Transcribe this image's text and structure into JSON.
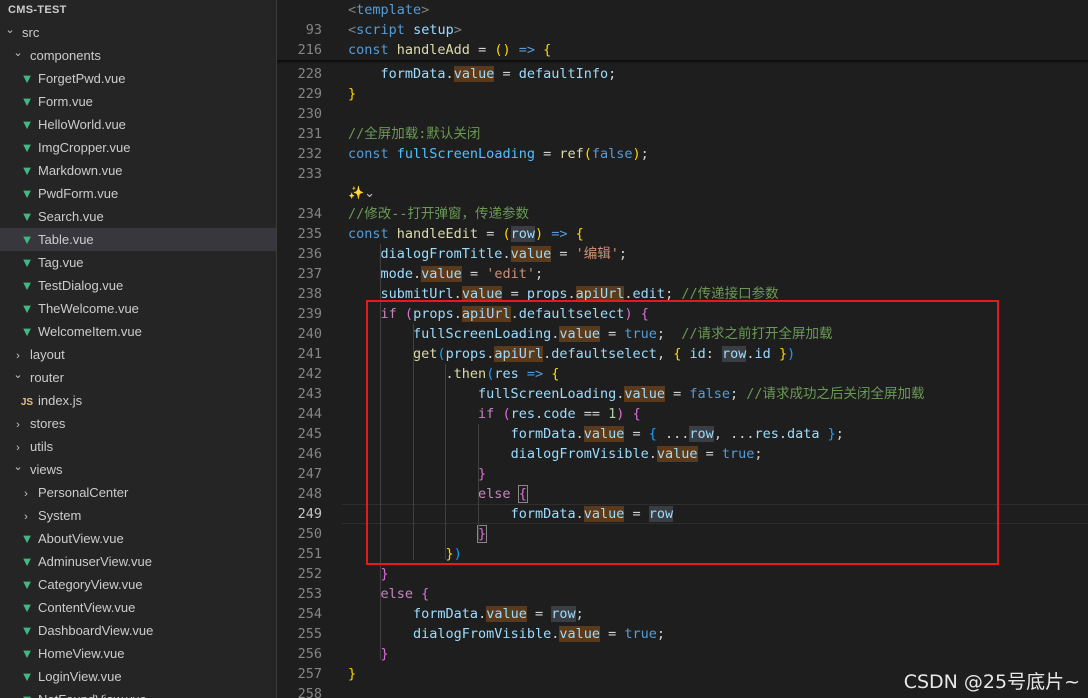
{
  "explorer": {
    "root_label": "CMS-TEST",
    "items": [
      {
        "label": "src",
        "kind": "folder-open",
        "indent": 0
      },
      {
        "label": "components",
        "kind": "folder-open",
        "indent": 1
      },
      {
        "label": "ForgetPwd.vue",
        "kind": "vue",
        "indent": 2
      },
      {
        "label": "Form.vue",
        "kind": "vue",
        "indent": 2
      },
      {
        "label": "HelloWorld.vue",
        "kind": "vue",
        "indent": 2
      },
      {
        "label": "ImgCropper.vue",
        "kind": "vue",
        "indent": 2
      },
      {
        "label": "Markdown.vue",
        "kind": "vue",
        "indent": 2
      },
      {
        "label": "PwdForm.vue",
        "kind": "vue",
        "indent": 2
      },
      {
        "label": "Search.vue",
        "kind": "vue",
        "indent": 2
      },
      {
        "label": "Table.vue",
        "kind": "vue",
        "indent": 2,
        "selected": true
      },
      {
        "label": "Tag.vue",
        "kind": "vue",
        "indent": 2
      },
      {
        "label": "TestDialog.vue",
        "kind": "vue",
        "indent": 2
      },
      {
        "label": "TheWelcome.vue",
        "kind": "vue",
        "indent": 2
      },
      {
        "label": "WelcomeItem.vue",
        "kind": "vue",
        "indent": 2
      },
      {
        "label": "layout",
        "kind": "folder-closed",
        "indent": 1
      },
      {
        "label": "router",
        "kind": "folder-open",
        "indent": 1
      },
      {
        "label": "index.js",
        "kind": "js",
        "indent": 2
      },
      {
        "label": "stores",
        "kind": "folder-closed",
        "indent": 1
      },
      {
        "label": "utils",
        "kind": "folder-closed",
        "indent": 1
      },
      {
        "label": "views",
        "kind": "folder-open",
        "indent": 1
      },
      {
        "label": "PersonalCenter",
        "kind": "folder-closed",
        "indent": 2
      },
      {
        "label": "System",
        "kind": "folder-closed",
        "indent": 2
      },
      {
        "label": "AboutView.vue",
        "kind": "vue",
        "indent": 2
      },
      {
        "label": "AdminuserView.vue",
        "kind": "vue",
        "indent": 2
      },
      {
        "label": "CategoryView.vue",
        "kind": "vue",
        "indent": 2
      },
      {
        "label": "ContentView.vue",
        "kind": "vue",
        "indent": 2
      },
      {
        "label": "DashboardView.vue",
        "kind": "vue",
        "indent": 2
      },
      {
        "label": "HomeView.vue",
        "kind": "vue",
        "indent": 2
      },
      {
        "label": "LoginView.vue",
        "kind": "vue",
        "indent": 2
      },
      {
        "label": "NotFoundView.vue",
        "kind": "vue",
        "indent": 2
      }
    ]
  },
  "editor": {
    "active_line": "249",
    "sticky": [
      {
        "ln": "",
        "html": "<span class='tag'>&lt;</span><span class='tagn'>template</span><span class='tag'>&gt;</span>"
      },
      {
        "ln": "93",
        "html": "<span class='tag'>&lt;</span><span class='tagn'>script</span> <span class='var'>setup</span><span class='tag'>&gt;</span>"
      },
      {
        "ln": "216",
        "html": "<span class='kw'>const</span> <span class='fn'>handleAdd</span> = <span class='b1'>()</span> <span class='kw'>=&gt;</span> <span class='b1'>{</span>"
      }
    ],
    "lines": [
      {
        "ln": "228",
        "html": "    <span class='var'>formData</span>.<span class='var hlo'>value</span> = <span class='var'>defaultInfo</span>;"
      },
      {
        "ln": "229",
        "html": "<span class='b1'>}</span>"
      },
      {
        "ln": "230",
        "html": ""
      },
      {
        "ln": "231",
        "html": "<span class='cm'>//全屏加载:默认关闭</span>"
      },
      {
        "ln": "232",
        "html": "<span class='kw'>const</span> <span class='const'>fullScreenLoading</span> = <span class='fn'>ref</span><span class='b1'>(</span><span class='kw'>false</span><span class='b1'>)</span>;"
      },
      {
        "ln": "233",
        "html": ""
      },
      {
        "ln": "",
        "codelens": true
      },
      {
        "ln": "234",
        "html": "<span class='cm'>//修改--打开弹窗，传递参数</span>"
      },
      {
        "ln": "235",
        "html": "<span class='kw'>const</span> <span class='fn'>handleEdit</span> = <span class='b1'>(</span><span class='var hl'>row</span><span class='b1'>)</span> <span class='kw'>=&gt;</span> <span class='b1'>{</span>"
      },
      {
        "ln": "236",
        "html": "    <span class='var'>dialogFromTitle</span>.<span class='var hlo'>value</span> = <span class='str'>'编辑'</span>;"
      },
      {
        "ln": "237",
        "html": "    <span class='var'>mode</span>.<span class='var hlo'>value</span> = <span class='str'>'edit'</span>;"
      },
      {
        "ln": "238",
        "html": "    <span class='var'>submitUrl</span>.<span class='var hlo'>value</span> = <span class='var'>props</span>.<span class='var hlo'>apiUrl</span>.<span class='var'>edit</span>; <span class='cm'>//传递接口参数</span>"
      },
      {
        "ln": "239",
        "html": "    <span class='ctrl'>if</span> <span class='b2'>(</span><span class='var'>props</span>.<span class='var hlo'>apiUrl</span>.<span class='var'>defaultselect</span><span class='b2'>)</span> <span class='b2'>{</span>"
      },
      {
        "ln": "240",
        "html": "        <span class='var'>fullScreenLoading</span>.<span class='var hlo'>value</span> = <span class='kw'>true</span>;  <span class='cm'>//请求之前打开全屏加载</span>"
      },
      {
        "ln": "241",
        "html": "        <span class='fn'>get</span><span class='b3'>(</span><span class='var'>props</span>.<span class='var hlo'>apiUrl</span>.<span class='var'>defaultselect</span>, <span class='b1'>{</span> <span class='var'>id</span>: <span class='var hl'>row</span>.<span class='var'>id</span> <span class='b1'>}</span><span class='b3'>)</span>"
      },
      {
        "ln": "242",
        "html": "            .<span class='fn'>then</span><span class='b3'>(</span><span class='var'>res</span> <span class='kw'>=&gt;</span> <span class='b1'>{</span>"
      },
      {
        "ln": "243",
        "html": "                <span class='var'>fullScreenLoading</span>.<span class='var hlo'>value</span> = <span class='kw'>false</span>; <span class='cm'>//请求成功之后关闭全屏加载</span>"
      },
      {
        "ln": "244",
        "html": "                <span class='ctrl'>if</span> <span class='b2'>(</span><span class='var'>res</span>.<span class='var'>code</span> == <span class='num'>1</span><span class='b2'>)</span> <span class='b2'>{</span>"
      },
      {
        "ln": "245",
        "html": "                    <span class='var'>formData</span>.<span class='var hlo'>value</span> = <span class='b3'>{</span> ...<span class='var hl'>row</span>, ...<span class='var'>res</span>.<span class='var'>data</span> <span class='b3'>}</span>;"
      },
      {
        "ln": "246",
        "html": "                    <span class='var'>dialogFromVisible</span>.<span class='var hlo'>value</span> = <span class='kw'>true</span>;"
      },
      {
        "ln": "247",
        "html": "                <span class='b2'>}</span>"
      },
      {
        "ln": "248",
        "html": "                <span class='ctrl'>else</span> <span class='b2' style='outline:1px solid #888'>{</span>"
      },
      {
        "ln": "249",
        "html": "                    <span class='var'>formData</span>.<span class='var hlo'>value</span> = <span class='var hl'>row</span>",
        "active": true
      },
      {
        "ln": "250",
        "html": "                <span class='b2' style='outline:1px solid #888'>}</span>"
      },
      {
        "ln": "251",
        "html": "            <span class='b1'>}</span><span class='b3'>)</span>"
      },
      {
        "ln": "252",
        "html": "    <span class='b2'>}</span>"
      },
      {
        "ln": "253",
        "html": "    <span class='ctrl'>else</span> <span class='b2'>{</span>"
      },
      {
        "ln": "254",
        "html": "        <span class='var'>formData</span>.<span class='var hlo'>value</span> = <span class='var hl'>row</span>;"
      },
      {
        "ln": "255",
        "html": "        <span class='var'>dialogFromVisible</span>.<span class='var hlo'>value</span> = <span class='kw'>true</span>;"
      },
      {
        "ln": "256",
        "html": "    <span class='b2'>}</span>"
      },
      {
        "ln": "257",
        "html": "<span class='b1'>}</span>"
      },
      {
        "ln": "258",
        "html": ""
      }
    ]
  },
  "watermark": "CSDN @25号底片~",
  "colors": {
    "red_box": "#e51a1a",
    "vue_icon": "#41b883",
    "accent": "#569cd6"
  }
}
